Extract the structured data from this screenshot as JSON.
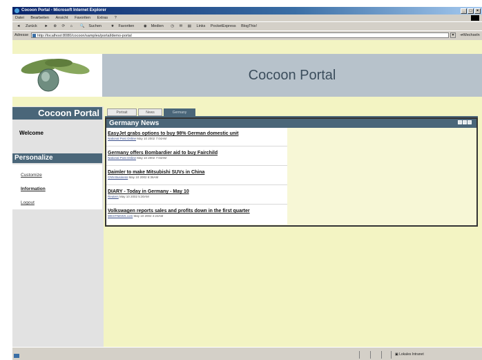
{
  "window": {
    "title": "Cocoon Portal - Microsoft Internet Explorer",
    "controls": [
      "_",
      "□",
      "×"
    ]
  },
  "menu": [
    "Datei",
    "Bearbeiten",
    "Ansicht",
    "Favoriten",
    "Extras",
    "?"
  ],
  "toolbar": {
    "back": "Zurück",
    "search": "Suchen",
    "favorites": "Favoriten",
    "media": "Medien",
    "links_label": "Links",
    "links": [
      "PocketExpress",
      "BlogThis!"
    ]
  },
  "address": {
    "label": "Adresse",
    "url": "http://localhost:8080/cocoon/samples/portal/demo-portal",
    "go": "Wechseln zu"
  },
  "portal": {
    "title": "Cocoon Portal",
    "sidebar_title": "Cocoon Portal",
    "welcome": "Welcome",
    "personalize": "Personalize",
    "links": [
      "Customize",
      "Information",
      "Logout"
    ]
  },
  "tabs": [
    {
      "label": "Portrait",
      "active": false
    },
    {
      "label": "News",
      "active": false
    },
    {
      "label": "Germany",
      "active": true
    }
  ],
  "news": {
    "title": "Germany News",
    "items": [
      {
        "headline": "EasyJet grabs options to buy 98% German domestic unit",
        "source": "National Post Online",
        "date": "May 10 2002 7:04AM"
      },
      {
        "headline": "Germany offers Bombardier aid to buy Fairchild",
        "source": "National Post Online",
        "date": "May 10 2002 7:03AM"
      },
      {
        "headline": "Daimler to make Mitsubishi SUVs in China",
        "source": "CNN Business",
        "date": "May 10 2002 6:36AM"
      },
      {
        "headline": "DIARY - Today in Germany - May 10",
        "source": "Reuters",
        "date": "May 10 2002 5:30AM"
      },
      {
        "headline": "Volkswagen reports sales and profits down in the first quarter",
        "source": "WESTNEWS.com",
        "date": "May 10 2002 4:23AM"
      }
    ]
  },
  "status": {
    "zone": "Lokales Intranet"
  }
}
